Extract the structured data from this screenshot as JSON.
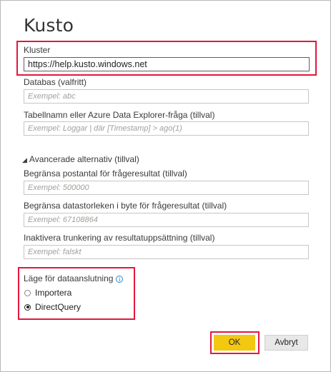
{
  "dialog": {
    "title": "Kusto"
  },
  "cluster": {
    "label": "Kluster",
    "value": "https://help.kusto.windows.net"
  },
  "database": {
    "label": "Databas (valfritt)",
    "placeholder": "Exempel: abc"
  },
  "table": {
    "label": "Tabellnamn eller Azure Data Explorer-fråga (tillval)",
    "placeholder": "Exempel: Loggar | där [Timestamp] > ago(1)"
  },
  "advanced": {
    "label": "Avancerade alternativ (tillval)",
    "record_limit": {
      "label": "Begränsa postantal för frågeresultat (tillval)",
      "placeholder": "Exempel: 500000"
    },
    "size_limit": {
      "label": "Begränsa datastorleken i byte för frågeresultat (tillval)",
      "placeholder": "Exempel: 67108864"
    },
    "truncation": {
      "label": "Inaktivera trunkering av resultatuppsättning (tillval)",
      "placeholder": "Exempel: falskt"
    }
  },
  "connectivity": {
    "label": "Läge för dataanslutning",
    "info_icon": "info-icon",
    "options": [
      {
        "label": "Importera",
        "selected": false
      },
      {
        "label": "DirectQuery",
        "selected": true
      }
    ]
  },
  "buttons": {
    "ok": "OK",
    "cancel": "Avbryt"
  },
  "colors": {
    "highlight": "#e3173e",
    "ok_button": "#f2c811"
  }
}
